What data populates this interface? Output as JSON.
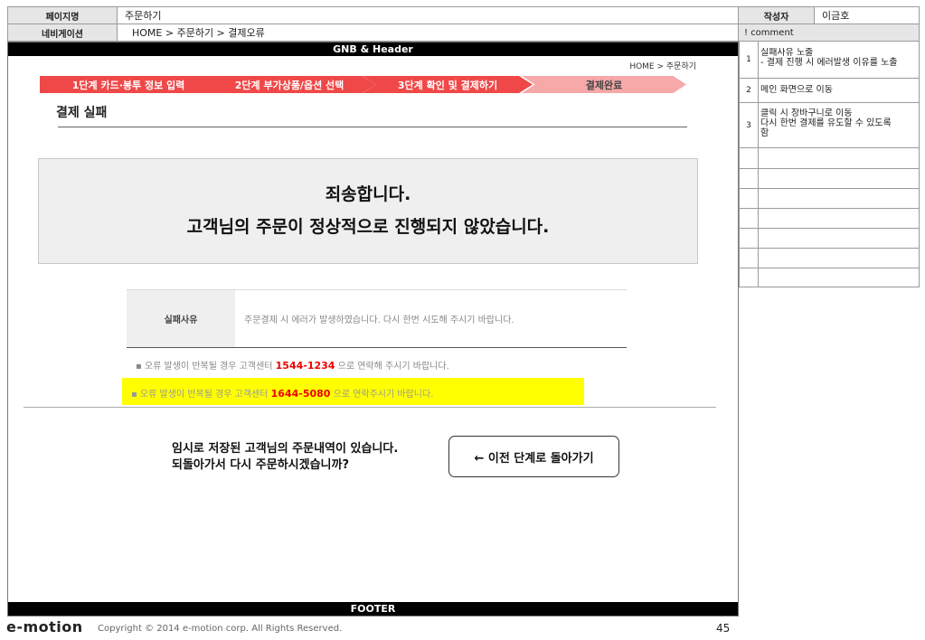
{
  "meta": {
    "page_name_label": "페이지명",
    "page_name": "주문하기",
    "nav_label": "네비게이션",
    "nav_path": "HOME > 주문하기 > 결제오류",
    "author_label": "작성자",
    "author": "이금호",
    "comment_label": "! comment"
  },
  "header": {
    "gnb": "GNB & Header",
    "breadcrumb": "HOME >  주문하기"
  },
  "steps": [
    {
      "label": "1단계  카드·봉투 정보 입력",
      "color": "#f04848"
    },
    {
      "label": "2단계  부가상품/옵션 선택",
      "color": "#f04848"
    },
    {
      "label": "3단계 확인 및 결제하기",
      "color": "#f04848"
    },
    {
      "label": "결제완료",
      "color": "#f7a8a8"
    }
  ],
  "main": {
    "title": "결제 실패",
    "message_line1": "죄송합니다.",
    "message_line2": "고객님의 주문이 정상적으로 진행되지 않았습니다.",
    "reason_label": "실패사유",
    "reason_text": "주문결제 시 에러가 발생하였습니다. 다시 한번 시도해 주시기 바랍니다.",
    "note1_pre": "▪ 오류 발생이 반복될 경우 고객센터 ",
    "note1_phone": "1544-1234",
    "note1_post": " 으로 연락해 주시기 바랍니다.",
    "note2_pre": "▪ 오류 발생이 반복될 경우 고객센터 ",
    "note2_phone": "1644-5080",
    "note2_post": " 으로 연락주시기 바랍니다.",
    "saved_line1": "임시로 저장된 고객님의 주문내역이 있습니다.",
    "saved_line2": "되돌아가서 다시 주문하시겠습니까?",
    "back_button": "← 이전 단계로 돌아가기"
  },
  "footer": {
    "label": "FOOTER",
    "logo": "e-motion",
    "copyright": "Copyright © 2014 e-motion corp. All Rights Reserved.",
    "page_number": "45"
  },
  "comments": [
    {
      "num": "1",
      "text": "실패사유 노출\n- 결제 진행 시 에러발생 이유를 노출"
    },
    {
      "num": "2",
      "text": "메인 화면으로 이동"
    },
    {
      "num": "3",
      "text": "클릭 시 장바구니로 이동\n다시 한번 결제를 유도할 수 있도록\n함"
    },
    {
      "num": "",
      "text": ""
    },
    {
      "num": "",
      "text": ""
    },
    {
      "num": "",
      "text": ""
    },
    {
      "num": "",
      "text": ""
    },
    {
      "num": "",
      "text": ""
    },
    {
      "num": "",
      "text": ""
    },
    {
      "num": "",
      "text": ""
    }
  ]
}
